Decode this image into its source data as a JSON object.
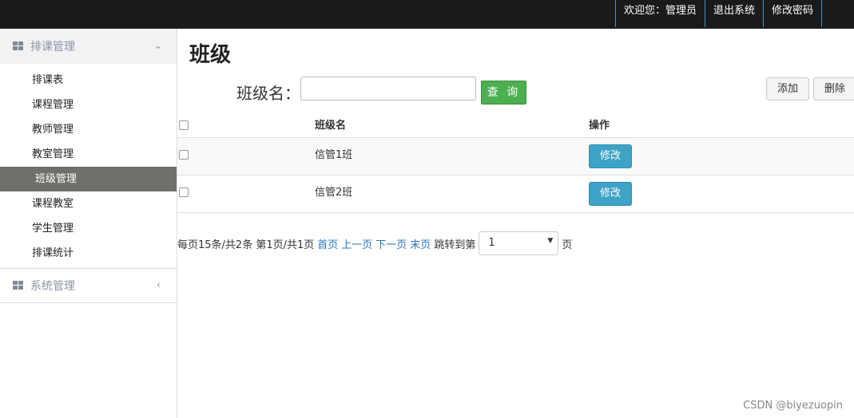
{
  "topnav": {
    "welcome": "欢迎您：管理员",
    "logout": "退出系统",
    "change_password": "修改密码"
  },
  "sidebar": {
    "group1": {
      "label": "排课管理",
      "icon": "grid-icon",
      "chevron": "chevron-down-icon"
    },
    "items": [
      {
        "label": "排课表"
      },
      {
        "label": "课程管理"
      },
      {
        "label": "教师管理"
      },
      {
        "label": "教室管理"
      },
      {
        "label": "班级管理"
      },
      {
        "label": "课程教室"
      },
      {
        "label": "学生管理"
      },
      {
        "label": "排课统计"
      }
    ],
    "active_item": "班级管理",
    "group2": {
      "label": "系统管理",
      "icon": "grid-icon",
      "chevron": "chevron-left-icon"
    }
  },
  "main": {
    "title": "班级",
    "search": {
      "label": "班级名：",
      "value": "",
      "button": "查 询"
    },
    "actions": {
      "add": "添加",
      "delete": "删除"
    },
    "table": {
      "headers": {
        "name": "班级名",
        "op": "操作"
      },
      "rows": [
        {
          "name": "信管1班",
          "edit": "修改"
        },
        {
          "name": "信管2班",
          "edit": "修改"
        }
      ]
    },
    "pager": {
      "summary": "每页15条/共2条 第1页/共1页",
      "first": "首页",
      "prev": "上一页",
      "next": "下一页",
      "last": "末页",
      "jump_label": "跳转到第",
      "page_value": "1",
      "page_suffix": "页"
    }
  },
  "watermark": "CSDN @biyezuopin"
}
